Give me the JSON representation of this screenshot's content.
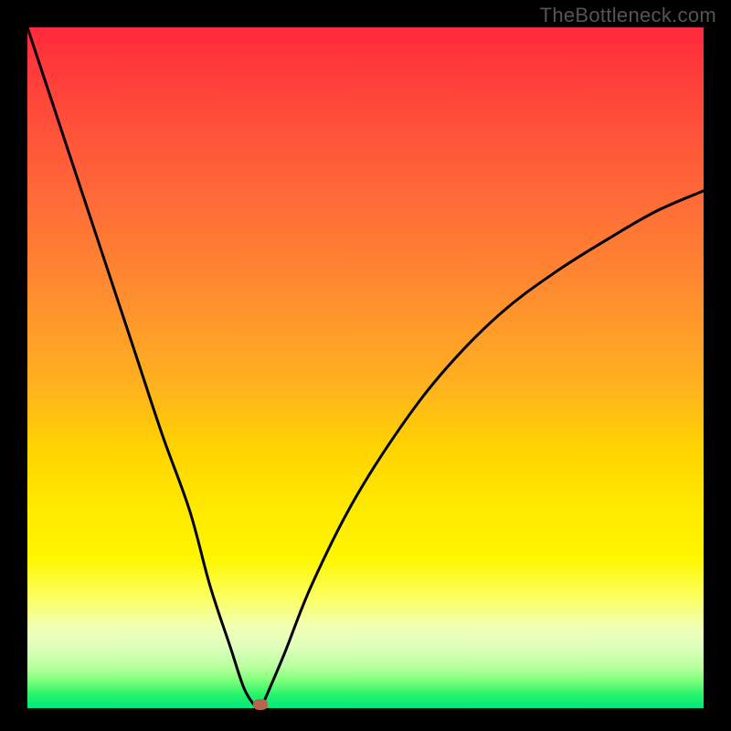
{
  "watermark": "TheBottleneck.com",
  "chart_data": {
    "type": "line",
    "title": "",
    "xlabel": "",
    "ylabel": "",
    "xlim": [
      0,
      100
    ],
    "ylim": [
      0,
      100
    ],
    "grid": false,
    "legend": false,
    "background_gradient": {
      "stops": [
        {
          "pos": 0,
          "color": "#ff2a3a"
        },
        {
          "pos": 50,
          "color": "#ffb020"
        },
        {
          "pos": 75,
          "color": "#fff200"
        },
        {
          "pos": 95,
          "color": "#a8ff8e"
        },
        {
          "pos": 100,
          "color": "#00e87d"
        }
      ]
    },
    "series": [
      {
        "name": "left-branch",
        "x": [
          0,
          4,
          8,
          12,
          16,
          20,
          24,
          27,
          30,
          32,
          33.5
        ],
        "values": [
          100,
          88,
          76,
          64,
          52,
          40,
          29,
          18,
          9,
          3,
          0.5
        ]
      },
      {
        "name": "right-branch",
        "x": [
          35,
          38,
          42,
          48,
          55,
          62,
          70,
          78,
          86,
          93,
          100
        ],
        "values": [
          1,
          8,
          18,
          30,
          41,
          50,
          58,
          64,
          69,
          73,
          76
        ]
      }
    ],
    "marker": {
      "name": "bottleneck-point",
      "x": 34.5,
      "y": 0.5,
      "color": "#b96450"
    }
  }
}
